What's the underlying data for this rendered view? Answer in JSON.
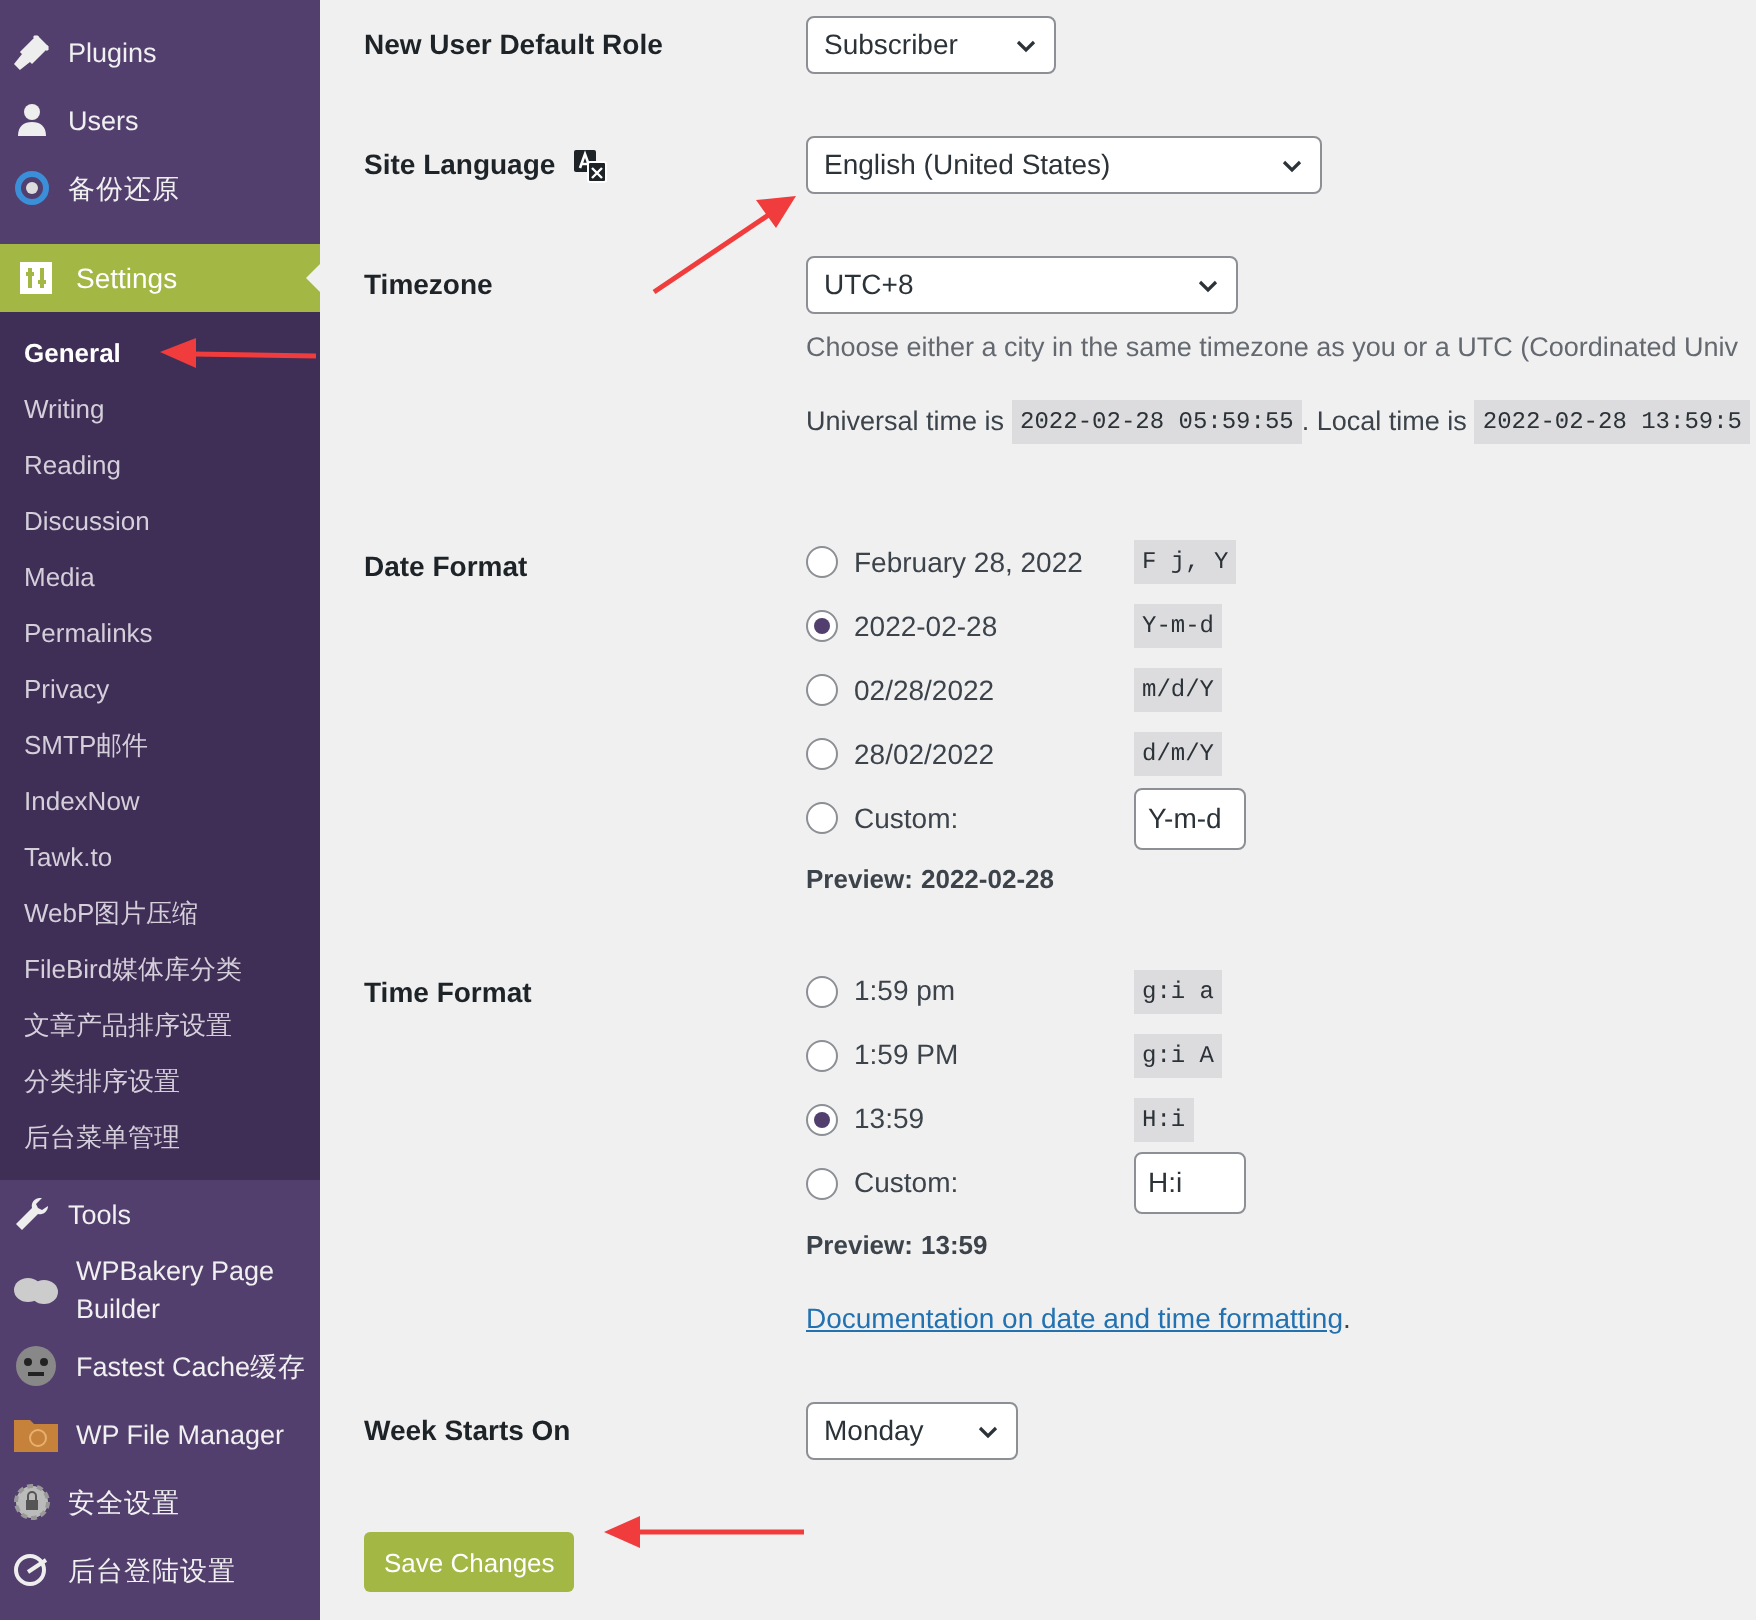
{
  "sidebar": {
    "top_items": [
      {
        "label": "Plugins"
      },
      {
        "label": "Users"
      },
      {
        "label": "备份还原"
      }
    ],
    "active_menu": {
      "label": "Settings"
    },
    "submenu": [
      {
        "label": "General",
        "selected": true
      },
      {
        "label": "Writing",
        "selected": false
      },
      {
        "label": "Reading",
        "selected": false
      },
      {
        "label": "Discussion",
        "selected": false
      },
      {
        "label": "Media",
        "selected": false
      },
      {
        "label": "Permalinks",
        "selected": false
      },
      {
        "label": "Privacy",
        "selected": false
      },
      {
        "label": "SMTP邮件",
        "selected": false
      },
      {
        "label": "IndexNow",
        "selected": false
      },
      {
        "label": "Tawk.to",
        "selected": false
      },
      {
        "label": "WebP图片压缩",
        "selected": false
      },
      {
        "label": "FileBird媒体库分类",
        "selected": false
      },
      {
        "label": "文章产品排序设置",
        "selected": false
      },
      {
        "label": "分类排序设置",
        "selected": false
      },
      {
        "label": "后台菜单管理",
        "selected": false
      }
    ],
    "bottom_items": [
      {
        "label": "Tools"
      },
      {
        "label": "WPBakery Page Builder"
      },
      {
        "label": "Fastest Cache缓存"
      },
      {
        "label": "WP File Manager"
      },
      {
        "label": "安全设置"
      },
      {
        "label": "后台登陆设置"
      }
    ]
  },
  "settings": {
    "default_role": {
      "label": "New User Default Role",
      "value": "Subscriber"
    },
    "site_language": {
      "label": "Site Language",
      "value": "English (United States)"
    },
    "timezone": {
      "label": "Timezone",
      "value": "UTC+8",
      "description": "Choose either a city in the same timezone as you or a UTC (Coordinated Univ",
      "universal_label": "Universal time is",
      "universal_value": "2022-02-28 05:59:55",
      "local_label": ". Local time is",
      "local_value": "2022-02-28 13:59:5"
    },
    "date_format": {
      "label": "Date Format",
      "options": [
        {
          "kind": "preset",
          "label": "February 28, 2022",
          "code": "F j, Y",
          "selected": false
        },
        {
          "kind": "preset",
          "label": "2022-02-28",
          "code": "Y-m-d",
          "selected": true
        },
        {
          "kind": "preset",
          "label": "02/28/2022",
          "code": "m/d/Y",
          "selected": false
        },
        {
          "kind": "preset",
          "label": "28/02/2022",
          "code": "d/m/Y",
          "selected": false
        },
        {
          "kind": "custom",
          "label": "Custom:",
          "value": "Y-m-d",
          "selected": false
        }
      ],
      "preview_label": "Preview:",
      "preview_value": "2022-02-28"
    },
    "time_format": {
      "label": "Time Format",
      "options": [
        {
          "kind": "preset",
          "label": "1:59 pm",
          "code": "g:i a",
          "selected": false
        },
        {
          "kind": "preset",
          "label": "1:59 PM",
          "code": "g:i A",
          "selected": false
        },
        {
          "kind": "preset",
          "label": "13:59",
          "code": "H:i",
          "selected": true
        },
        {
          "kind": "custom",
          "label": "Custom:",
          "value": "H:i",
          "selected": false
        }
      ],
      "preview_label": "Preview:",
      "preview_value": "13:59",
      "doc_link": "Documentation on date and time formatting",
      "doc_suffix": "."
    },
    "week_start": {
      "label": "Week Starts On",
      "value": "Monday"
    },
    "save_button": "Save Changes"
  }
}
